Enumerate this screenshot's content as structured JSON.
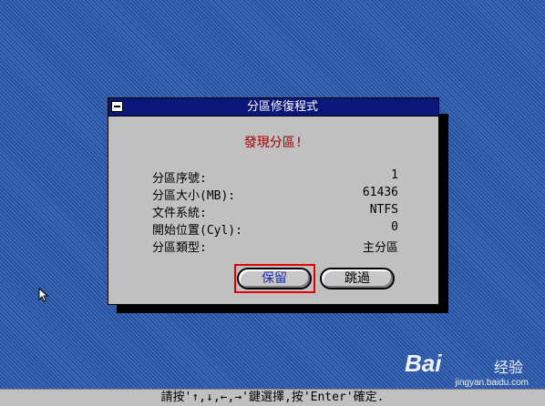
{
  "dialog": {
    "title": "分區修復程式",
    "found_text": "發現分區!",
    "fields": [
      {
        "label": "分區序號:",
        "value": "1"
      },
      {
        "label": "分區大小(MB):",
        "value": "61436"
      },
      {
        "label": "文件系統:",
        "value": "NTFS"
      },
      {
        "label": "開始位置(Cyl):",
        "value": "0"
      },
      {
        "label": "分區類型:",
        "value": "主分區"
      }
    ],
    "buttons": {
      "keep": "保留",
      "skip": "跳過"
    }
  },
  "statusbar": {
    "text": "請按'↑,↓,←,→'鍵選擇,按'Enter'確定."
  },
  "watermark": {
    "brand": "Bai",
    "brand_cn": "经验",
    "url": "jingyan.baidu.com"
  },
  "colors": {
    "desktop": "#2e5aa8",
    "titlebar": "#0a1678",
    "dialog": "#c0c0c0",
    "alert": "#a00000",
    "focus": "#e00000"
  }
}
